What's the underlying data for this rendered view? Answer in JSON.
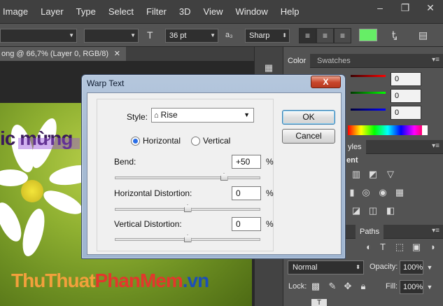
{
  "menubar": {
    "items": [
      "Image",
      "Layer",
      "Type",
      "Select",
      "Filter",
      "3D",
      "View",
      "Window",
      "Help"
    ]
  },
  "window_controls": {
    "minimize": "–",
    "restore": "❐",
    "close": "✕"
  },
  "options_bar": {
    "font_size": "36 pt",
    "antialias": "Sharp",
    "text_color": "#66ee66"
  },
  "document": {
    "tab_label": "ong @ 66,7% (Layer 0, RGB/8)",
    "close": "✕"
  },
  "canvas": {
    "warped_text": "ic mừng",
    "watermark": {
      "part1": "ThuThuat",
      "part2": "PhanMem",
      "part3": ".vn"
    }
  },
  "panels": {
    "color_tabs": [
      "Color",
      "Swatches"
    ],
    "rgb_values": [
      "0",
      "0",
      "0"
    ],
    "styles_tab_partial": "yles",
    "adjustments_partial": "ent",
    "layers_tabs": [
      "Paths"
    ],
    "blend_mode": "Normal",
    "opacity_label": "Opacity:",
    "opacity_value": "100%",
    "lock_label": "Lock:",
    "fill_label": "Fill:",
    "fill_value": "100%"
  },
  "dialog": {
    "title": "Warp Text",
    "close": "X",
    "style_label": "Style:",
    "style_value": "Rise",
    "orientation": {
      "horizontal": "Horizontal",
      "vertical": "Vertical",
      "selected": "horizontal"
    },
    "bend": {
      "label": "Bend:",
      "value": "+50",
      "unit": "%",
      "slider": 0.75
    },
    "h_distortion": {
      "label": "Horizontal Distortion:",
      "value": "0",
      "unit": "%",
      "slider": 0.5
    },
    "v_distortion": {
      "label": "Vertical Distortion:",
      "value": "0",
      "unit": "%",
      "slider": 0.5
    },
    "ok_label": "OK",
    "cancel_label": "Cancel"
  }
}
